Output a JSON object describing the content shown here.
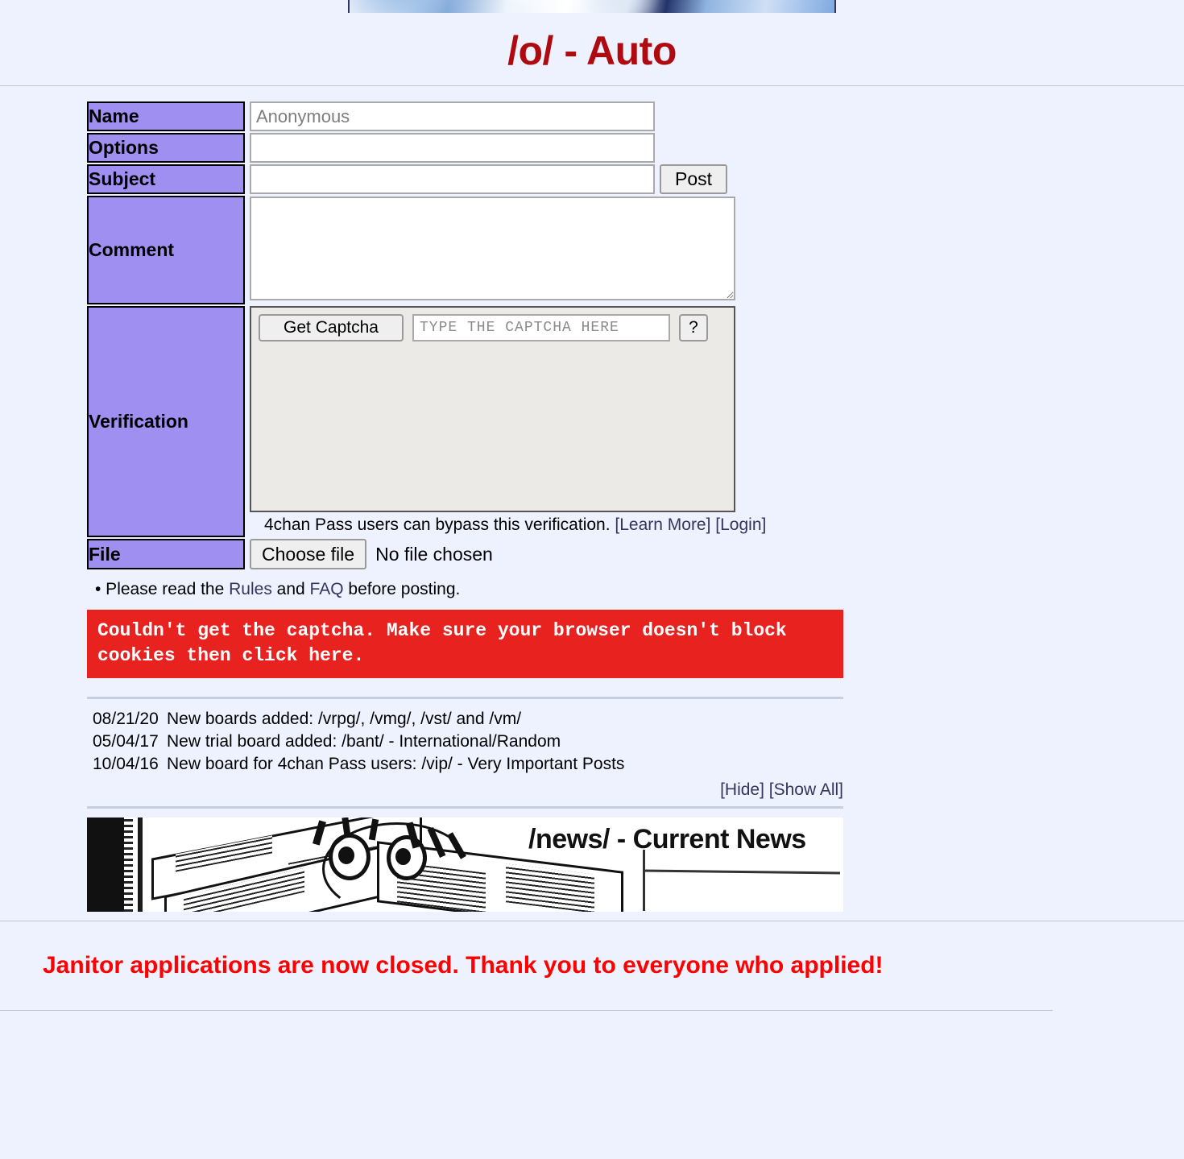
{
  "page": {
    "background_color": "#eef2ff",
    "title_color": "#af0a0f",
    "label_color": "#9f8ff0",
    "link_color": "#34345c",
    "error_color": "#e8221f",
    "notice_color": "#ff0000"
  },
  "header": {
    "banner_alt": "board-banner-image",
    "board_title": "/o/ - Auto"
  },
  "form": {
    "labels": {
      "name": "Name",
      "options": "Options",
      "subject": "Subject",
      "comment": "Comment",
      "verification": "Verification",
      "file": "File"
    },
    "name_value": "",
    "name_placeholder": "Anonymous",
    "options_value": "",
    "options_placeholder": "",
    "subject_value": "",
    "subject_placeholder": "",
    "comment_value": "",
    "comment_placeholder": "",
    "post_button": "Post",
    "captcha": {
      "get_button": "Get Captcha",
      "input_placeholder": "TYPE THE CAPTCHA HERE",
      "input_value": "",
      "help_button": "?"
    },
    "pass_note": {
      "text": "4chan Pass users can bypass this verification.",
      "learn_more": "[Learn More]",
      "login": "[Login]"
    },
    "file": {
      "choose_button": "Choose file",
      "status": "No file chosen"
    }
  },
  "rules_line": {
    "bullet": "• Please read the ",
    "rules_link": "Rules",
    "and": " and ",
    "faq_link": "FAQ",
    "tail": " before posting."
  },
  "error": {
    "line1": "Couldn't get the captcha. Make sure your browser doesn't block",
    "line2_prefix": "cookies then ",
    "line2_link": "click here",
    "line2_suffix": "."
  },
  "news": {
    "items": [
      {
        "date": "08/21/20",
        "prefix": "New boards added: ",
        "links": [
          "/vrpg/",
          "/vmg/",
          "/vst/",
          "/vm/"
        ],
        "text": "New boards added: /vrpg/, /vmg/, /vst/ and /vm/"
      },
      {
        "date": "05/04/17",
        "prefix": "New trial board added: ",
        "links": [
          "/bant/ - International/Random"
        ],
        "text": "New trial board added: /bant/ - International/Random"
      },
      {
        "date": "10/04/16",
        "prefix": "New board for 4chan Pass users: ",
        "links": [
          "/vip/ - Very Important Posts"
        ],
        "text": "New board for 4chan Pass users: /vip/ - Very Important Posts"
      }
    ],
    "hide": "[Hide]",
    "show_all": "[Show All]"
  },
  "news_banner": {
    "title": "/news/ - Current News",
    "alt": "news-banner-manga-newspaper"
  },
  "footer": {
    "janitor_notice": "Janitor applications are now closed. Thank you to everyone who applied!"
  }
}
